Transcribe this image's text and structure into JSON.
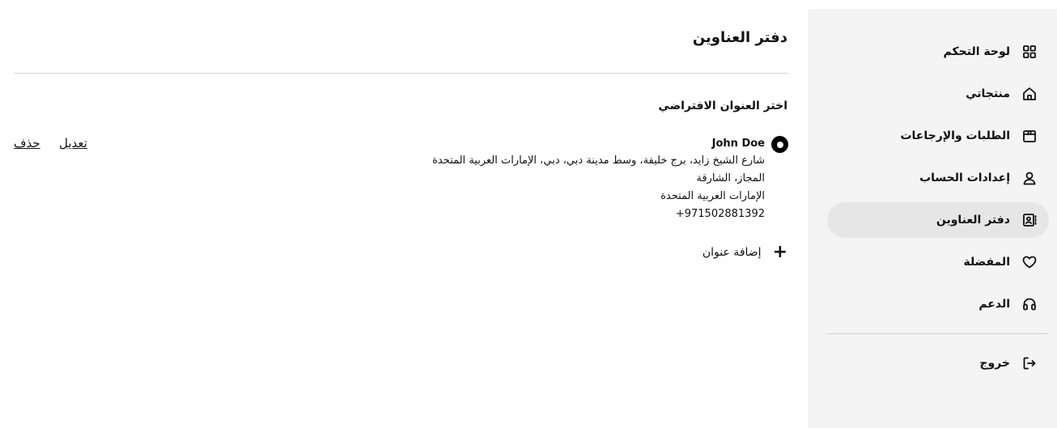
{
  "sidebar": {
    "items": [
      {
        "label": "لوحة التحكم",
        "icon": "dashboard-grid-icon"
      },
      {
        "label": "منتجاتي",
        "icon": "home-icon"
      },
      {
        "label": "الطلبات والإرجاعات",
        "icon": "box-icon"
      },
      {
        "label": "إعدادات الحساب",
        "icon": "user-icon"
      },
      {
        "label": "دفتر العناوين",
        "icon": "address-book-icon",
        "active": true
      },
      {
        "label": "المفضلة",
        "icon": "heart-icon"
      },
      {
        "label": "الدعم",
        "icon": "headset-icon"
      }
    ],
    "logout": {
      "label": "خروج",
      "icon": "logout-icon"
    }
  },
  "main": {
    "title": "دفتر العناوين",
    "section_title": "اختر العنوان الافتراضي",
    "address": {
      "name": "John Doe",
      "line1": "شارع الشيخ زايد، برج خليفة، وسط مدينة دبي، دبي، الإمارات العربية المتحدة",
      "line2": "المجاز، الشارقة",
      "line3": "الإمارات العربية المتحدة",
      "phone": "+971502881392",
      "selected": true
    },
    "edit_label": "تعديل",
    "delete_label": "حذف",
    "add_address_label": "إضافة عنوان"
  }
}
